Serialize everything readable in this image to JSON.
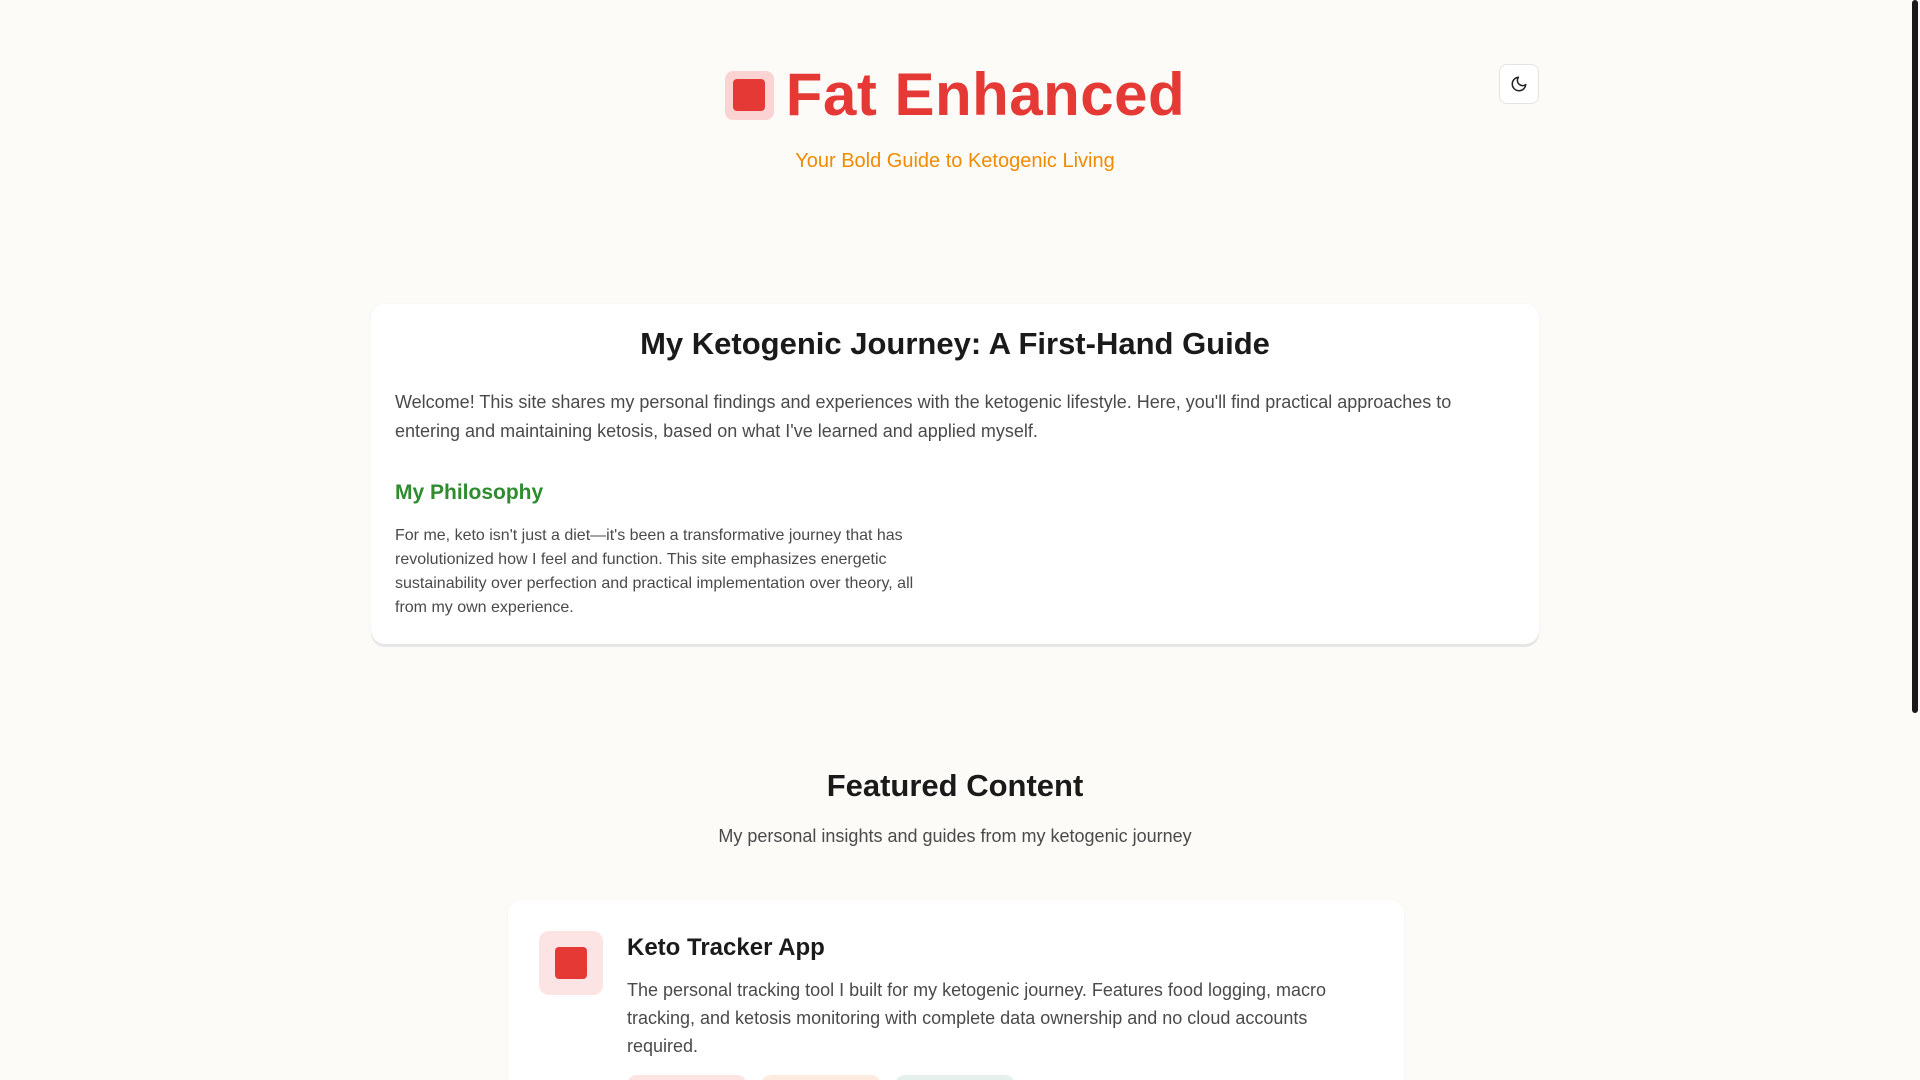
{
  "header": {
    "brand_title": "Fat Enhanced",
    "tagline": "Your Bold Guide to Ketogenic Living",
    "brand_color": "#e53935",
    "tagline_color": "#f08a00",
    "theme_toggle_icon": "moon-icon"
  },
  "intro": {
    "title": "My Ketogenic Journey: A First-Hand Guide",
    "text": "Welcome! This site shares my personal findings and experiences with the ketogenic lifestyle. Here, you'll find practical approaches to entering and maintaining ketosis, based on what I've learned and applied myself.",
    "philosophy_heading": "My Philosophy",
    "philosophy_heading_color": "#2e8b2e",
    "philosophy_text": "For me, keto isn't just a diet—it's been a transformative journey that has revolutionized how I feel and function. This site emphasizes energetic sustainability over perfection and practical implementation over theory, all from my own experience."
  },
  "featured": {
    "title": "Featured Content",
    "subtitle": "My personal insights and guides from my ketogenic journey",
    "cards": [
      {
        "title": "Keto Tracker App",
        "description": "The personal tracking tool I built for my ketogenic journey. Features food logging, macro tracking, and ketosis monitoring with complete data ownership and no cloud accounts required.",
        "icon": "app-square-icon"
      }
    ]
  }
}
